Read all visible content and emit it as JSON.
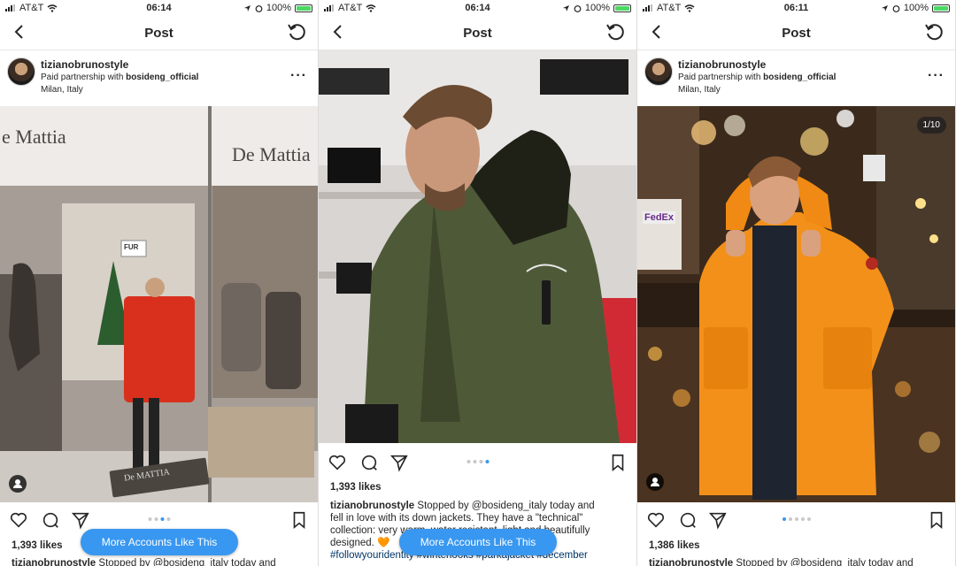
{
  "panels": [
    {
      "status": {
        "carrier": "AT&T",
        "time": "06:14",
        "battery": "100%"
      },
      "nav_title": "Post",
      "username": "tizianobrunostyle",
      "partnership_prefix": "Paid partnership with",
      "partner": "bosideng_official",
      "location": "Milan, Italy",
      "likes": "1,393 likes",
      "caption_user": "tizianobrunostyle",
      "caption_text": "Stopped by @bosideng_italy today and",
      "button": "More Accounts Like This",
      "store_sign_left": "e Mattia",
      "store_sign_right": "De Mattia",
      "fur_sign": "FUR",
      "mat_text": "De MATTIA"
    },
    {
      "status": {
        "carrier": "AT&T",
        "time": "06:14",
        "battery": "100%"
      },
      "nav_title": "Post",
      "likes": "1,393 likes",
      "caption_user": "tizianobrunostyle",
      "caption_line1": "Stopped by @bosideng_italy today and",
      "caption_line2": "fell in love with its down jackets. They have a \"technical\"",
      "caption_line3": "collection: very warm, water resistant, light and beautifully",
      "caption_line4": "designed. 🧡",
      "caption_line5": "#followyouridentity #winterlooks #parkajacket #december",
      "button": "More Accounts Like This"
    },
    {
      "status": {
        "carrier": "AT&T",
        "time": "06:11",
        "battery": "100%"
      },
      "nav_title": "Post",
      "username": "tizianobrunostyle",
      "partnership_prefix": "Paid partnership with",
      "partner": "bosideng_official",
      "location": "Milan, Italy",
      "counter": "1/10",
      "fedex": "FedEx",
      "likes": "1,386 likes",
      "caption_user": "tizianobrunostyle",
      "caption_text": "Stopped by @bosideng_italy today and"
    }
  ],
  "colors": {
    "accent": "#3897f0",
    "jacket_red": "#d9301e",
    "jacket_olive": "#4e5a37",
    "jacket_orange": "#f39019"
  }
}
